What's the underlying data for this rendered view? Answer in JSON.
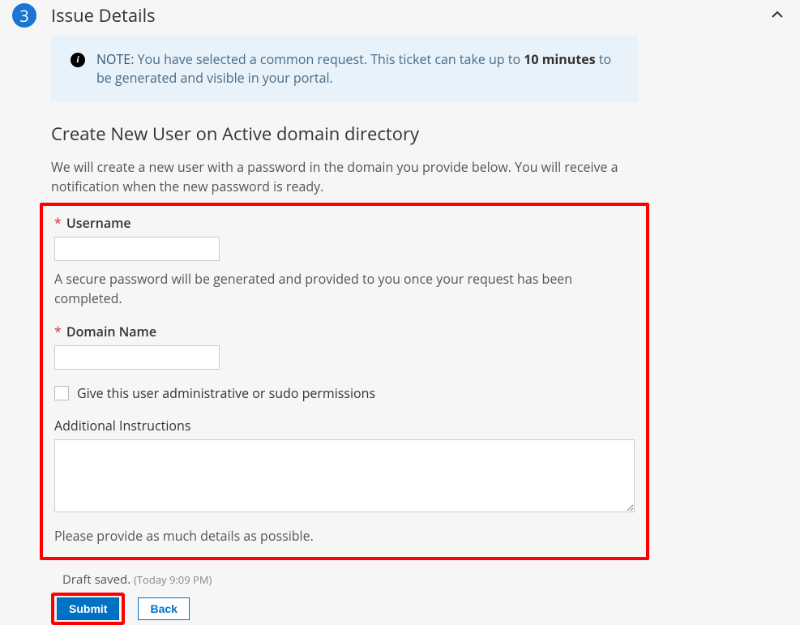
{
  "section": {
    "step": "3",
    "title": "Issue Details"
  },
  "note": {
    "label": "NOTE:",
    "text_before": " You have selected a common request. This ticket can take up to ",
    "bold": "10 minutes",
    "text_after": " to be generated and visible in your portal."
  },
  "form": {
    "heading": "Create New User on Active domain directory",
    "description": "We will create a new user with a password in the domain you provide below. You will receive a notification when the new password is ready.",
    "username_label": "Username",
    "username_help": "A secure password will be generated and provided to you once your request has been completed.",
    "domain_label": "Domain Name",
    "checkbox_label": "Give this user administrative or sudo permissions",
    "additional_label": "Additional Instructions",
    "additional_help": "Please provide as much details as possible."
  },
  "footer": {
    "draft_label": "Draft saved.",
    "draft_time": "(Today 9:09 PM)",
    "submit_label": "Submit",
    "back_label": "Back"
  }
}
